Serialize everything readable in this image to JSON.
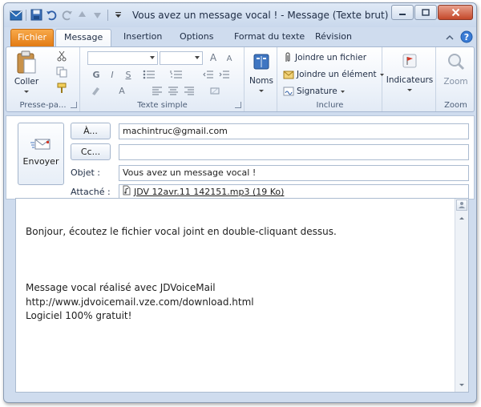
{
  "window": {
    "title": "Vous avez un message vocal !  -  Message (Texte brut)"
  },
  "tabs": {
    "file": "Fichier",
    "items": [
      "Message",
      "Insertion",
      "Options",
      "Format du texte",
      "Révision"
    ],
    "active": "Message"
  },
  "ribbon": {
    "clipboard": {
      "paste_label": "Coller",
      "group_label": "Presse-pa..."
    },
    "basic_text": {
      "bold": "G",
      "italic": "I",
      "underline": "S",
      "font_grow": "A",
      "font_shrink": "A",
      "group_label": "Texte simple"
    },
    "names": {
      "label": "Noms"
    },
    "include": {
      "attach_file": "Joindre un fichier",
      "attach_item": "Joindre un élément",
      "signature": "Signature",
      "group_label": "Inclure"
    },
    "tags": {
      "label": "Indicateurs"
    },
    "zoom": {
      "label": "Zoom",
      "group_label": "Zoom"
    }
  },
  "header": {
    "send_label": "Envoyer",
    "to_button": "À...",
    "cc_button": "Cc...",
    "subject_label": "Objet :",
    "attached_label": "Attaché :",
    "to_value": "machintruc@gmail.com",
    "cc_value": "",
    "subject_value": "Vous avez un message vocal !",
    "attachment": "JDV 12avr.11 142151.mp3 (19 Ko)"
  },
  "body": {
    "lines": [
      "Bonjour, écoutez le fichier vocal joint en double-cliquant dessus.",
      "",
      "",
      "",
      "Message vocal réalisé avec JDVoiceMail",
      "http://www.jdvoicemail.vze.com/download.html",
      "Logiciel 100% gratuit!"
    ]
  }
}
